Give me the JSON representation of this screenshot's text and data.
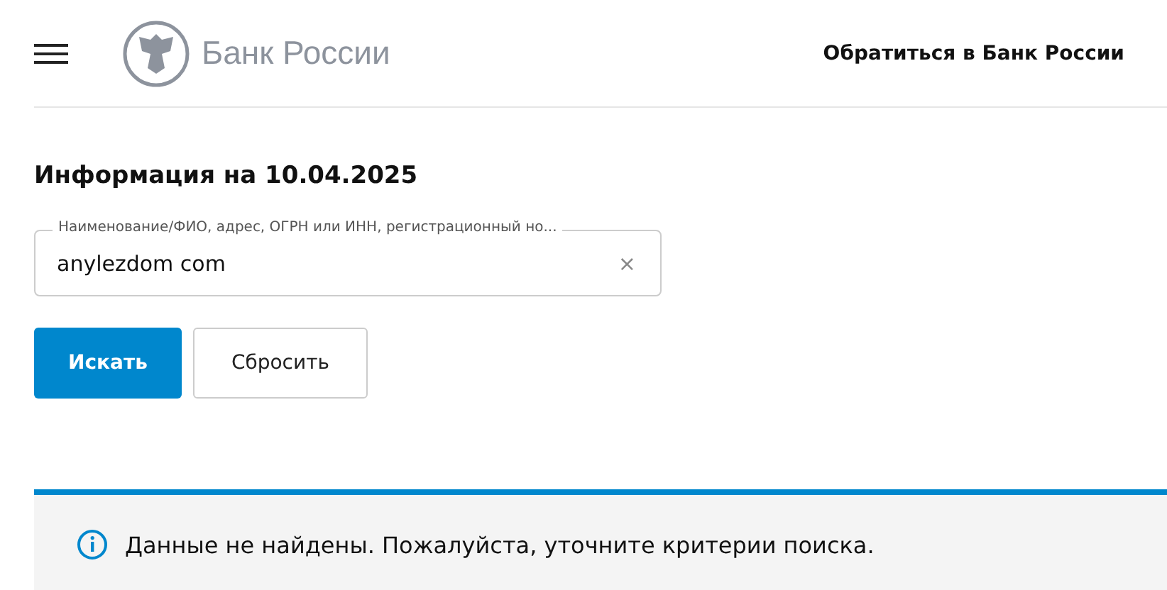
{
  "header": {
    "logo_text": "Банк России",
    "contact_link": "Обратиться в Банк России"
  },
  "title": "Информация на 10.04.2025",
  "search": {
    "label": "Наименование/ФИО, адрес, ОГРН или ИНН, регистрационный но...",
    "value": "anylezdom com",
    "clear": "×"
  },
  "buttons": [
    {
      "label": "Искать",
      "kind": "primary"
    },
    {
      "label": "Сбросить",
      "kind": "secondary"
    }
  ],
  "notice": {
    "text": "Данные не найдены. Пожалуйста, уточните критерии поиска."
  }
}
